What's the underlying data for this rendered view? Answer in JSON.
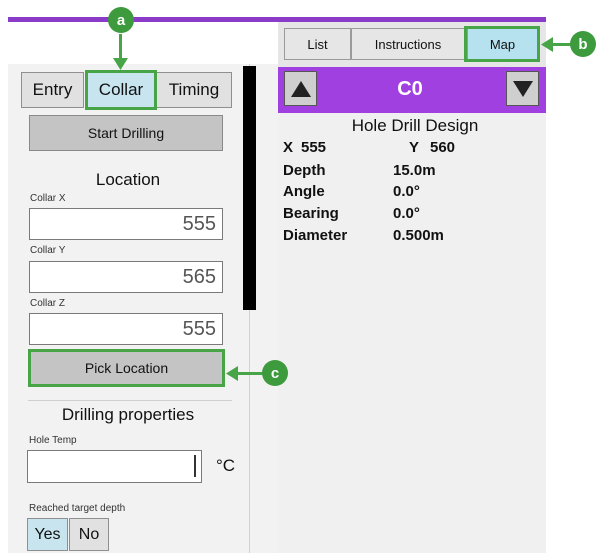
{
  "left_tabs": [
    "Entry",
    "Collar",
    "Timing"
  ],
  "start_drilling_label": "Start Drilling",
  "location": {
    "title": "Location",
    "collar_x_label": "Collar X",
    "collar_x": "555",
    "collar_y_label": "Collar Y",
    "collar_y": "565",
    "collar_z_label": "Collar Z",
    "collar_z": "555",
    "pick_location_label": "Pick Location"
  },
  "drilling_properties": {
    "title": "Drilling properties",
    "hole_temp_label": "Hole Temp",
    "hole_temp_unit": "°C",
    "hole_temp_value": "",
    "reached_target_depth_label": "Reached target depth",
    "yes_label": "Yes",
    "no_label": "No"
  },
  "right_tabs": [
    "List",
    "Instructions",
    "Map"
  ],
  "hole": {
    "id": "C0",
    "design_title": "Hole Drill Design",
    "x_label": "X",
    "x_value": "555",
    "y_label": "Y",
    "y_value": "560",
    "rows": [
      {
        "label": "Depth",
        "value": "15.0m"
      },
      {
        "label": "Angle",
        "value": "0.0°"
      },
      {
        "label": "Bearing",
        "value": "0.0°"
      },
      {
        "label": "Diameter",
        "value": "0.500m"
      }
    ]
  },
  "callouts": [
    "a",
    "b",
    "c"
  ],
  "colors": {
    "accent_purple": "#a040e0",
    "callout_green": "#47a447",
    "selected_tab": "#c7e4ef"
  },
  "icons": [
    "triangle-up-icon",
    "triangle-down-icon"
  ]
}
